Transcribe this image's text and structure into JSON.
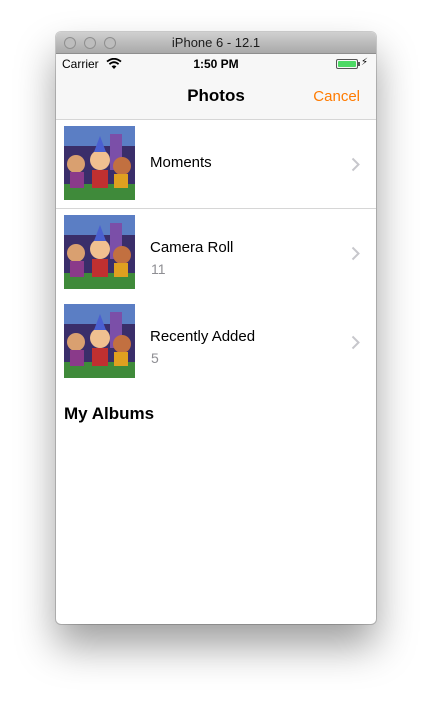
{
  "window": {
    "title": "iPhone 6 - 12.1"
  },
  "status_bar": {
    "carrier": "Carrier",
    "time": "1:50 PM",
    "battery_level_percent": 100,
    "battery_color": "#4cd964",
    "charging_symbol": "⚡"
  },
  "nav_bar": {
    "title": "Photos",
    "cancel_label": "Cancel",
    "accent_color": "#ff7b00"
  },
  "albums": [
    {
      "label": "Moments",
      "count": "",
      "icon": "chevron-right-icon"
    },
    {
      "label": "Camera Roll",
      "count": "11",
      "icon": "chevron-right-icon"
    },
    {
      "label": "Recently Added",
      "count": "5",
      "icon": "chevron-right-icon"
    }
  ],
  "my_albums": {
    "title": "My Albums"
  }
}
